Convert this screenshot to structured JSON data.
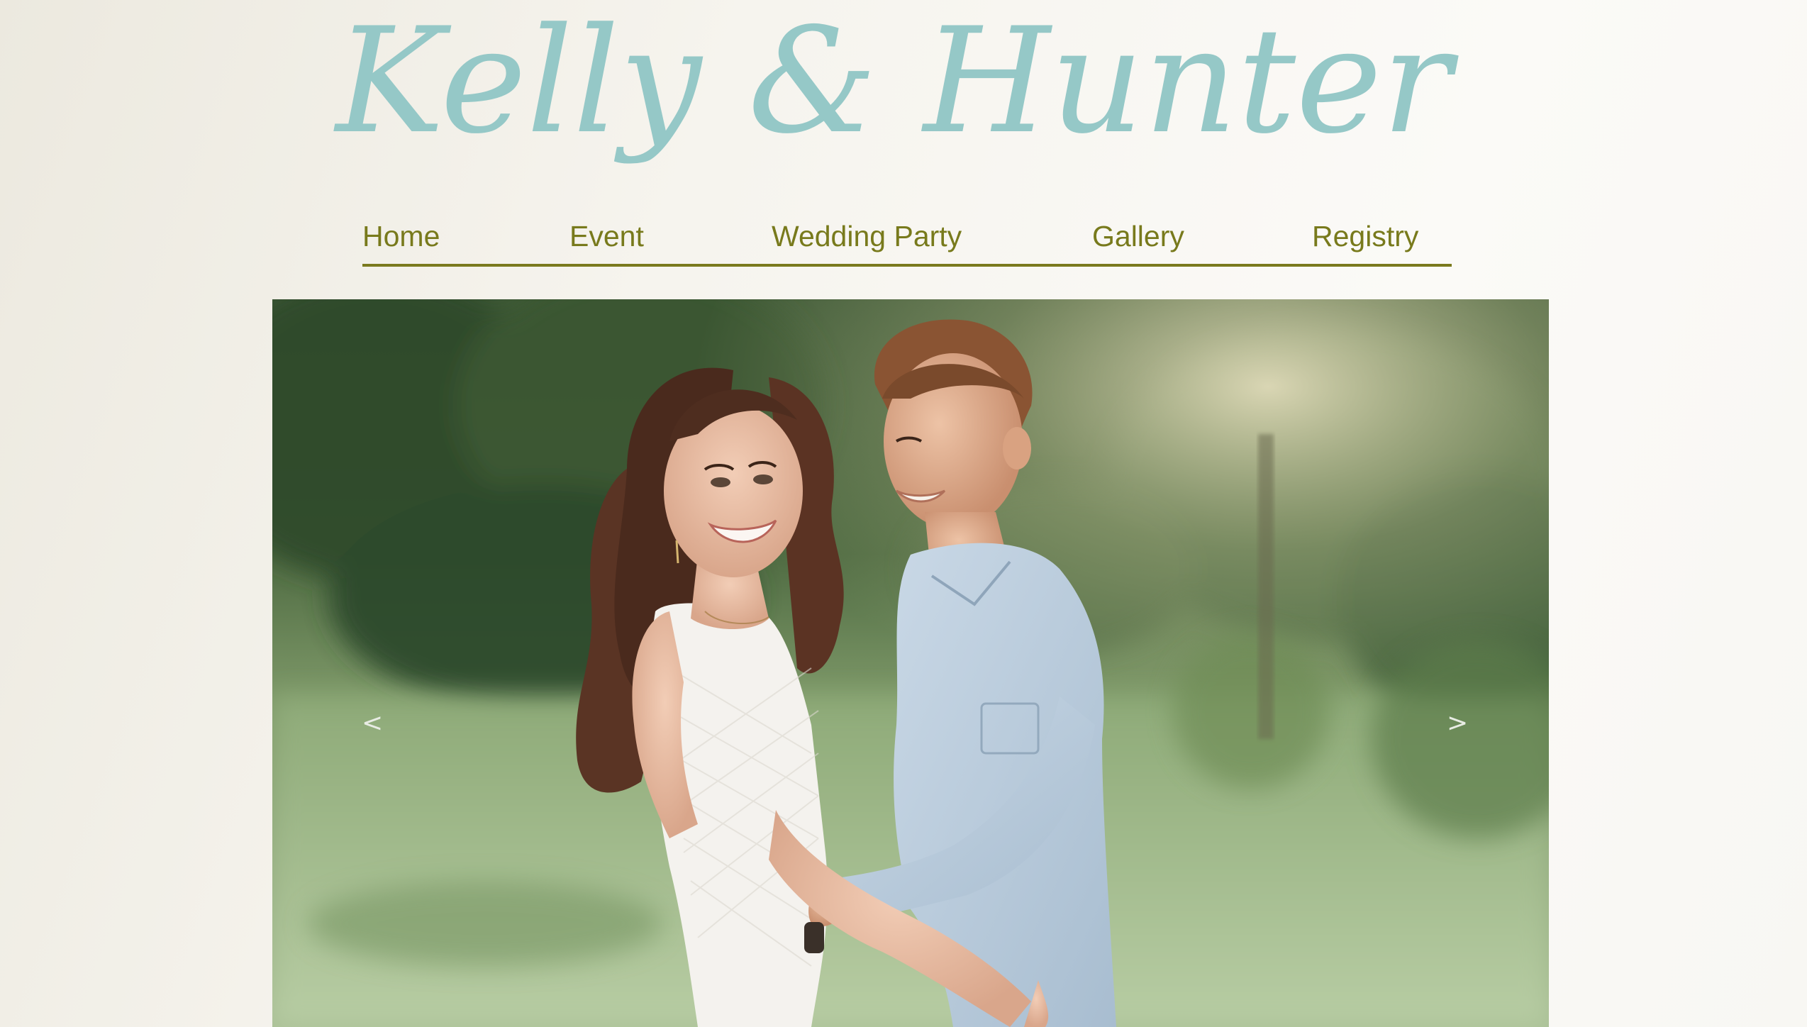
{
  "header": {
    "title": "Kelly & Hunter",
    "title_color": "#95c8c7"
  },
  "nav": {
    "items": [
      {
        "label": "Home"
      },
      {
        "label": "Event"
      },
      {
        "label": "Wedding Party"
      },
      {
        "label": "Gallery"
      },
      {
        "label": "Registry"
      }
    ],
    "text_color": "#787a1c",
    "underline_color": "#7a7a1e"
  },
  "carousel": {
    "prev_label": "<",
    "next_label": ">"
  }
}
